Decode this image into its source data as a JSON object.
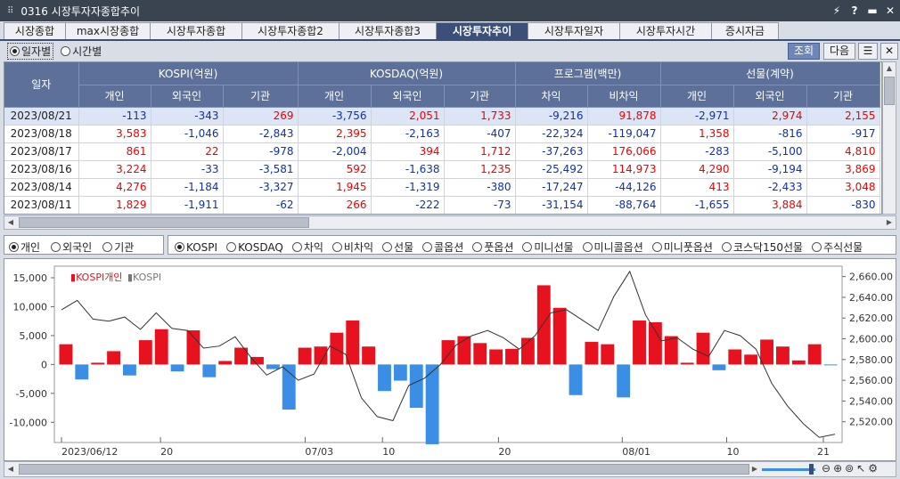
{
  "window": {
    "title": "0316 시장투자자종합추이",
    "buttons": [
      "⚡",
      "?",
      "▬",
      "✕"
    ]
  },
  "tabs": [
    "시장종합",
    "max시장종합",
    "시장투자종합",
    "시장투자종합2",
    "시장투자종합3",
    "시장투자추이",
    "시장투자일자",
    "시장투자시간",
    "증시자금"
  ],
  "active_tab": 5,
  "period": {
    "options": [
      "일자별",
      "시간별"
    ],
    "selected": 0
  },
  "buttons": {
    "inquiry": "조회",
    "next": "다음",
    "list": "☰",
    "close": "✕"
  },
  "table": {
    "date_header": "일자",
    "groups": [
      "KOSPI(억원)",
      "KOSDAQ(억원)",
      "프로그램(백만)",
      "선물(계약)"
    ],
    "subheaders": [
      "개인",
      "외국인",
      "기관",
      "개인",
      "외국인",
      "기관",
      "차익",
      "비차익",
      "개인",
      "외국인",
      "기관"
    ],
    "rows": [
      {
        "date": "2023/08/21",
        "v": [
          "-113",
          "-343",
          "269",
          "-3,756",
          "2,051",
          "1,733",
          "-9,216",
          "91,878",
          "-2,971",
          "2,974",
          "2,155"
        ]
      },
      {
        "date": "2023/08/18",
        "v": [
          "3,583",
          "-1,046",
          "-2,843",
          "2,395",
          "-2,163",
          "-407",
          "-22,324",
          "-119,047",
          "1,358",
          "-816",
          "-917"
        ]
      },
      {
        "date": "2023/08/17",
        "v": [
          "861",
          "22",
          "-978",
          "-2,004",
          "394",
          "1,712",
          "-37,263",
          "176,066",
          "-283",
          "-5,100",
          "4,810"
        ]
      },
      {
        "date": "2023/08/16",
        "v": [
          "3,224",
          "-33",
          "-3,581",
          "592",
          "-1,638",
          "1,235",
          "-25,492",
          "114,973",
          "4,290",
          "-9,194",
          "3,869"
        ]
      },
      {
        "date": "2023/08/14",
        "v": [
          "4,276",
          "-1,184",
          "-3,327",
          "1,945",
          "-1,319",
          "-380",
          "-17,247",
          "-44,126",
          "413",
          "-2,433",
          "3,048"
        ]
      },
      {
        "date": "2023/08/11",
        "v": [
          "1,829",
          "-1,911",
          "-62",
          "266",
          "-222",
          "-73",
          "-31,154",
          "-88,764",
          "-1,655",
          "3,884",
          "-830"
        ]
      }
    ]
  },
  "investor_options": [
    "개인",
    "외국인",
    "기관"
  ],
  "investor_selected": 0,
  "market_options": [
    "KOSPI",
    "KOSDAQ",
    "차익",
    "비차익",
    "선물",
    "콜옵션",
    "풋옵션",
    "미니선물",
    "미니콜옵션",
    "미니풋옵션",
    "코스닥150선물",
    "주식선물"
  ],
  "market_selected": 0,
  "chart_data": {
    "type": "bar",
    "legend": [
      "KOSPI개인",
      "KOSPI"
    ],
    "x_labels": [
      "2023/06/12",
      "20",
      "07/03",
      "10",
      "20",
      "08/01",
      "10",
      "21"
    ],
    "left_ticks": [
      "15,000",
      "10,000",
      "5,000",
      "0",
      "-5,000",
      "-10,000"
    ],
    "right_ticks": [
      "2,660.00",
      "2,640.00",
      "2,620.00",
      "2,600.00",
      "2,580.00",
      "2,560.00",
      "2,540.00",
      "2,520.00"
    ],
    "ylim_left": [
      -13500,
      17000
    ],
    "ylim_right": [
      2500,
      2670
    ],
    "colors": {
      "positive": "#e8121e",
      "negative": "#3a8ee6",
      "line": "#333333"
    },
    "bars": [
      3500,
      -2600,
      300,
      2300,
      -1900,
      4200,
      6100,
      -1200,
      5900,
      -2200,
      600,
      2900,
      1300,
      -800,
      -7800,
      2900,
      3100,
      5500,
      7600,
      3100,
      -4600,
      -2800,
      -7500,
      -13800,
      4200,
      4900,
      3700,
      2600,
      2700,
      4600,
      13700,
      9800,
      -5300,
      3900,
      3500,
      -5700,
      7600,
      7300,
      4900,
      300,
      5500,
      -1000,
      2600,
      1700,
      4300,
      3100,
      700,
      3500,
      -100
    ],
    "line": [
      2628,
      2637,
      2619,
      2617,
      2621,
      2609,
      2625,
      2610,
      2608,
      2591,
      2593,
      2602,
      2582,
      2565,
      2573,
      2560,
      2566,
      2593,
      2585,
      2543,
      2525,
      2521,
      2555,
      2562,
      2575,
      2594,
      2603,
      2608,
      2601,
      2590,
      2603,
      2625,
      2628,
      2618,
      2608,
      2641,
      2665,
      2623,
      2598,
      2601,
      2590,
      2583,
      2608,
      2603,
      2590,
      2557,
      2535,
      2518,
      2505,
      2508
    ]
  },
  "zoom": {
    "icons": [
      "zoom-out",
      "zoom-in",
      "zoom-fit",
      "cursor",
      "settings"
    ]
  }
}
